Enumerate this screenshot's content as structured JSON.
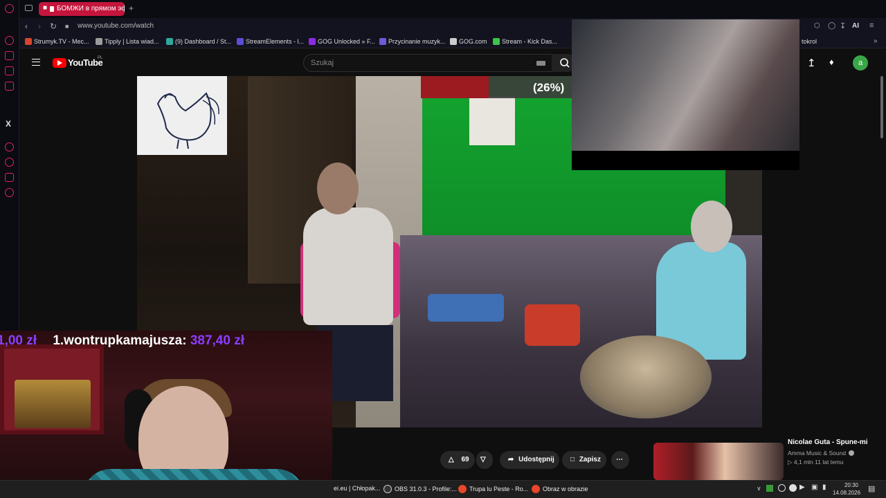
{
  "browser": {
    "active_tab_title": "БОМЖИ в прямом эфи",
    "url": "www.youtube.com/watch",
    "bookmarks": [
      "Strumyk.TV - Mec...",
      "Tipply | Lista wiad...",
      "(9) Dashboard / St...",
      "StreamElements - l...",
      "GOG Unlocked » F...",
      "Przycinanie muzyk...",
      "GOG.com",
      "Stream - Kick Das..."
    ],
    "bookmark_overflow": "tokrol",
    "toolbar_ai_label": "AI"
  },
  "youtube": {
    "logo_text": "YouTube",
    "region": "PL",
    "search_placeholder": "Szukaj",
    "avatar_letter": "a",
    "like_count": "69",
    "share_label": "Udostępnij",
    "save_label": "Zapisz"
  },
  "overlay": {
    "progress_text": "(26%)",
    "progress_fraction": 0.45,
    "donor_left_amount": "1,00 zł",
    "donor_name": "1.wontrupkamajusza:",
    "donor_amount": "387,40 zł"
  },
  "recommendation": {
    "title": "Nicolae Guta - Spune-mi",
    "channel": "Amma Music & Sound",
    "meta": "4,1 mln   11 lat temu"
  },
  "taskbar": {
    "items": [
      "ei.eu | Chłopak...",
      "OBS 31.0.3 - Profile:...",
      "Trupa lu Peste - Ro...",
      "Obraz w obrazie"
    ],
    "time": "20:30",
    "date": "14.08.2026"
  }
}
